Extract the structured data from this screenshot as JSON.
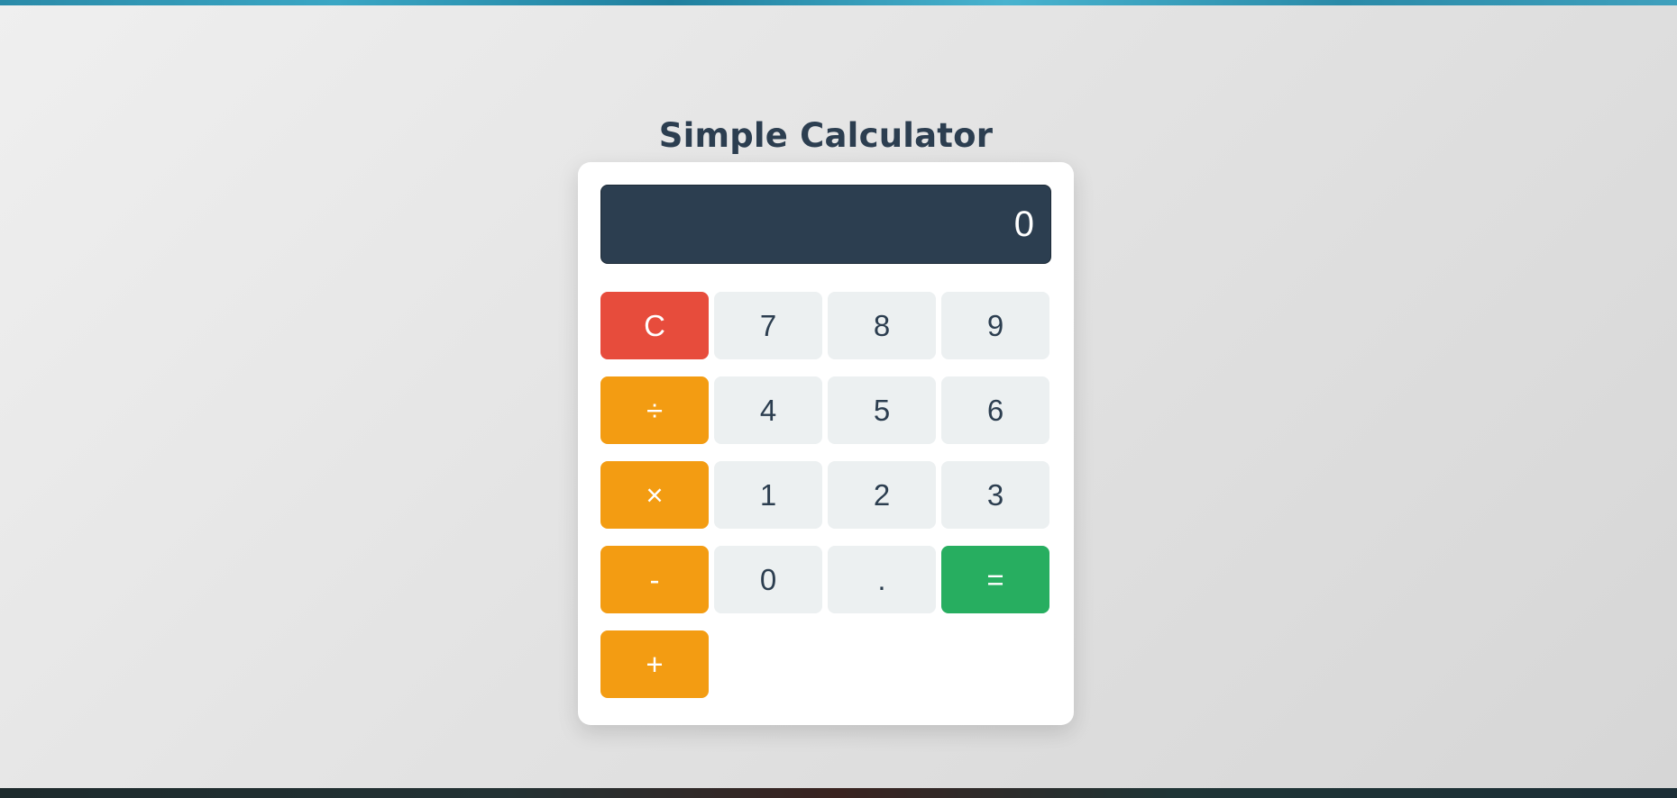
{
  "page": {
    "title": "Simple Calculator"
  },
  "display": {
    "value": "0"
  },
  "buttons": {
    "clear": "C",
    "seven": "7",
    "eight": "8",
    "nine": "9",
    "divide": "÷",
    "four": "4",
    "five": "5",
    "six": "6",
    "multiply": "×",
    "one": "1",
    "two": "2",
    "three": "3",
    "subtract": "-",
    "zero": "0",
    "decimal": ".",
    "equals": "=",
    "add": "+"
  },
  "colors": {
    "display_bg": "#2c3e50",
    "number_key": "#ecf0f1",
    "operator_key": "#f39c12",
    "clear_key": "#e74c3c",
    "equals_key": "#27ae60",
    "title_text": "#2c3e50"
  }
}
